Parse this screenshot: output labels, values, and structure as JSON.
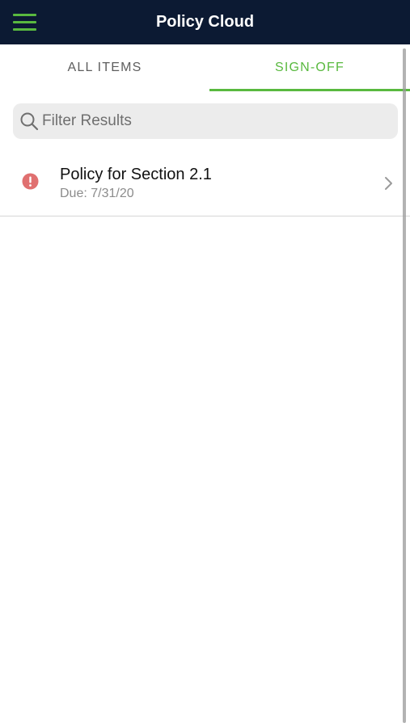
{
  "header": {
    "title": "Policy Cloud",
    "menu_icon": "hamburger-menu-icon"
  },
  "tabs": [
    {
      "label": "ALL ITEMS",
      "active": false
    },
    {
      "label": "SIGN-OFF",
      "active": true
    }
  ],
  "search": {
    "placeholder": "Filter Results",
    "value": "",
    "icon": "search-icon"
  },
  "list": {
    "items": [
      {
        "title": "Policy for Section 2.1",
        "due": "Due: 7/31/20",
        "status_icon": "alert-icon",
        "trailing_icon": "chevron-right-icon"
      }
    ]
  },
  "colors": {
    "header_bg": "#0c1a33",
    "accent": "#59b93f",
    "alert": "#e07070",
    "search_bg": "#ececec"
  }
}
